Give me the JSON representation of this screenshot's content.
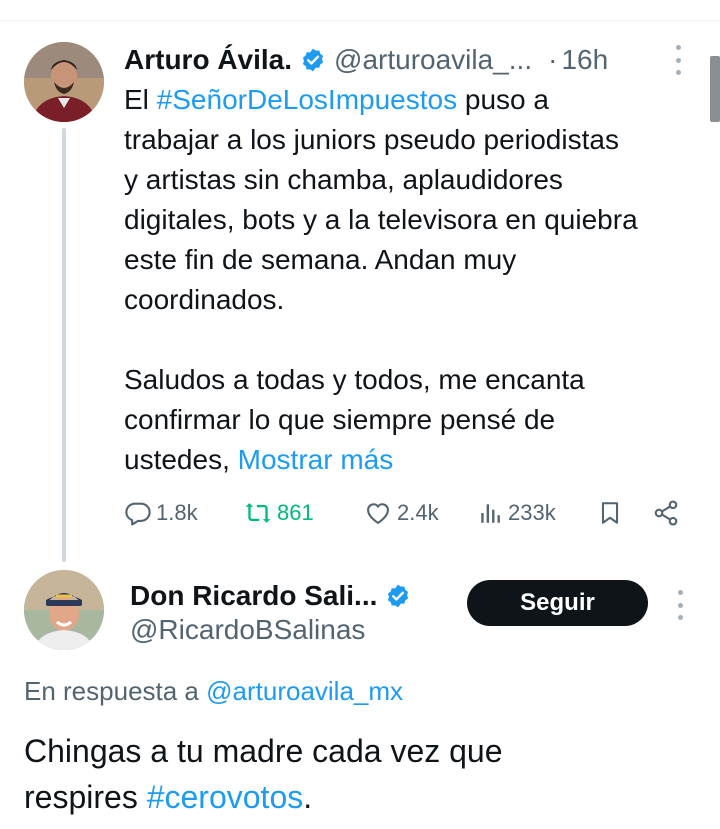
{
  "tweet1": {
    "author_name": "Arturo Ávila.",
    "handle": "@arturoavila_...",
    "separator": "·",
    "time": "16h",
    "text_lines": [
      {
        "pre": "El ",
        "hashtag": "#SeñorDeLosImpuestos",
        "post": " puso a"
      },
      "trabajar a los juniors pseudo periodistas",
      "y artistas sin chamba, aplaudidores",
      "digitales, bots y a la televisora en quiebra",
      "este fin de semana. Andan muy",
      "coordinados."
    ],
    "text_lines_2": [
      "Saludos a todas y todos, me encanta",
      "confirmar lo que siempre pensé de",
      {
        "pre": "ustedes, ",
        "link": "Mostrar más"
      }
    ],
    "actions": {
      "replies": "1.8k",
      "retweets": "861",
      "likes": "2.4k",
      "views": "233k"
    }
  },
  "tweet2": {
    "author_name": "Don Ricardo Sali...",
    "handle": "@RicardoBSalinas",
    "follow_label": "Seguir",
    "reply_to_prefix": "En respuesta a ",
    "reply_to_handle": "@arturoavila_mx",
    "text_pre": "Chingas a tu madre cada vez que",
    "text_line2_pre": "respires ",
    "text_hashtag": "#cerovotos",
    "text_post": "."
  },
  "colors": {
    "accent": "#1d9bf0",
    "retweet": "#00ba7c",
    "secondary": "#536471",
    "primary_text": "#0f1419"
  },
  "icons": [
    "verified-badge-icon",
    "more-icon",
    "reply-icon",
    "retweet-icon",
    "like-icon",
    "views-icon",
    "bookmark-icon",
    "share-icon"
  ]
}
